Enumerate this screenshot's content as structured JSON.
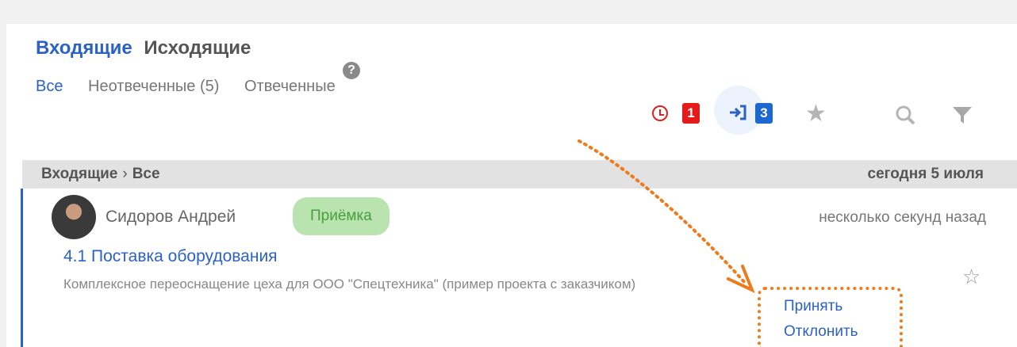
{
  "header": {
    "tab_incoming": "Входящие",
    "tab_outgoing": "Исходящие",
    "help_icon": "?",
    "filters": {
      "all": "Все",
      "unanswered": "Неотвеченные (5)",
      "answered": "Отвеченные"
    },
    "toolbar": {
      "clock_badge": "1",
      "incoming_badge": "3"
    }
  },
  "breadcrumb": {
    "root": "Входящие",
    "separator": "›",
    "current": "Все",
    "date": "сегодня 5 июля"
  },
  "item": {
    "author": "Сидоров Андрей",
    "tag": "Приёмка",
    "time": "несколько секунд назад",
    "subject": "4.1 Поставка оборудования",
    "description": "Комплексное переоснащение цеха для ООО \"Спецтехника\" (пример проекта с заказчиком)",
    "accept_label": "Принять",
    "decline_label": "Отклонить"
  },
  "colors": {
    "accent": "#2b62c4",
    "badge_red": "#e51a1a",
    "badge_blue": "#1d68d0",
    "tag_bg": "#b9e4b0",
    "tag_text": "#4a9e3e",
    "annotation": "#ef7a1a"
  },
  "icons": [
    "help-icon",
    "clock-icon",
    "enter-icon",
    "star-icon",
    "search-icon",
    "filter-icon",
    "star-outline-icon"
  ]
}
